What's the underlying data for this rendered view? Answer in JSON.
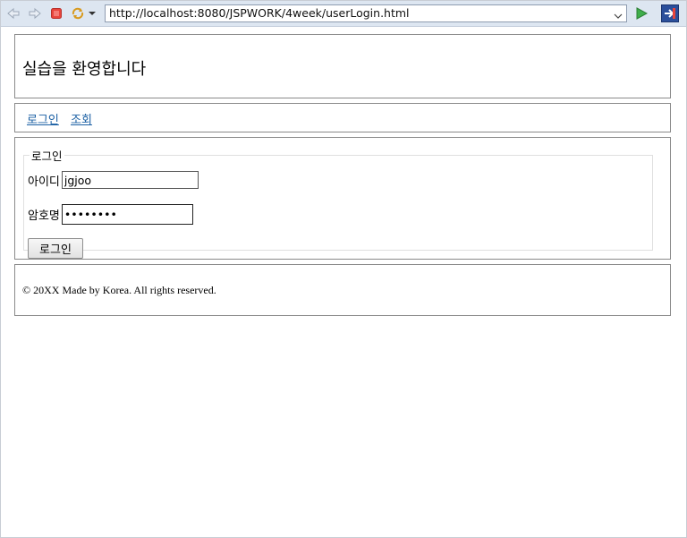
{
  "browser": {
    "url": "http://localhost:8080/JSPWORK/4week/userLogin.html",
    "icons": [
      "back-icon",
      "forward-icon",
      "stop-icon",
      "refresh-icon",
      "menu-dropdown-icon",
      "url-dropdown-icon",
      "go-icon",
      "eclipse-icon"
    ]
  },
  "header": {
    "title": "실습을 환영합니다"
  },
  "nav": {
    "items": [
      "로그인",
      "조회"
    ]
  },
  "login_form": {
    "legend": "로그인",
    "id_label": "아이디",
    "id_value": "jgjoo",
    "password_label": "암호명",
    "password_value": "password",
    "submit_label": "로그인"
  },
  "footer": {
    "text": "© 20XX Made by Korea. All rights reserved."
  },
  "colors": {
    "toolbar_bg": "#dde6f1",
    "link": "#1a5fa3",
    "border": "#8a8a8a"
  }
}
